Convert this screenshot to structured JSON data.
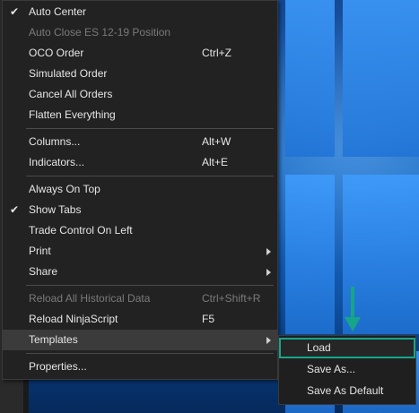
{
  "menu": {
    "items": [
      {
        "label": "Auto Center",
        "checked": true,
        "enabled": true,
        "shortcut": ""
      },
      {
        "label": "Auto Close ES 12-19 Position",
        "checked": false,
        "enabled": false,
        "shortcut": ""
      },
      {
        "label": "OCO Order",
        "checked": false,
        "enabled": true,
        "shortcut": "Ctrl+Z"
      },
      {
        "label": "Simulated Order",
        "checked": false,
        "enabled": true,
        "shortcut": ""
      },
      {
        "label": "Cancel All Orders",
        "checked": false,
        "enabled": true,
        "shortcut": ""
      },
      {
        "label": "Flatten Everything",
        "checked": false,
        "enabled": true,
        "shortcut": ""
      },
      {
        "label": "Columns...",
        "checked": false,
        "enabled": true,
        "shortcut": "Alt+W"
      },
      {
        "label": "Indicators...",
        "checked": false,
        "enabled": true,
        "shortcut": "Alt+E"
      },
      {
        "label": "Always On Top",
        "checked": false,
        "enabled": true,
        "shortcut": ""
      },
      {
        "label": "Show Tabs",
        "checked": true,
        "enabled": true,
        "shortcut": ""
      },
      {
        "label": "Trade Control On Left",
        "checked": false,
        "enabled": true,
        "shortcut": ""
      },
      {
        "label": "Print",
        "checked": false,
        "enabled": true,
        "shortcut": "",
        "submenu": true
      },
      {
        "label": "Share",
        "checked": false,
        "enabled": true,
        "shortcut": "",
        "submenu": true
      },
      {
        "label": "Reload All Historical Data",
        "checked": false,
        "enabled": false,
        "shortcut": "Ctrl+Shift+R"
      },
      {
        "label": "Reload NinjaScript",
        "checked": false,
        "enabled": true,
        "shortcut": "F5"
      },
      {
        "label": "Templates",
        "checked": false,
        "enabled": true,
        "shortcut": "",
        "submenu": true,
        "active": true
      },
      {
        "label": "Properties...",
        "checked": false,
        "enabled": true,
        "shortcut": ""
      }
    ],
    "check_glyph": "✔"
  },
  "submenu": {
    "items": [
      {
        "label": "Load",
        "highlighted": true
      },
      {
        "label": "Save As..."
      },
      {
        "label": "Save As Default"
      }
    ]
  },
  "colors": {
    "menu_bg": "#222223",
    "highlight_outline": "#17a589",
    "annotation_arrow": "#17a589"
  },
  "icons": {
    "check": "check-icon",
    "submenu_arrow": "chevron-right-icon",
    "annotation": "arrow-down-icon"
  }
}
